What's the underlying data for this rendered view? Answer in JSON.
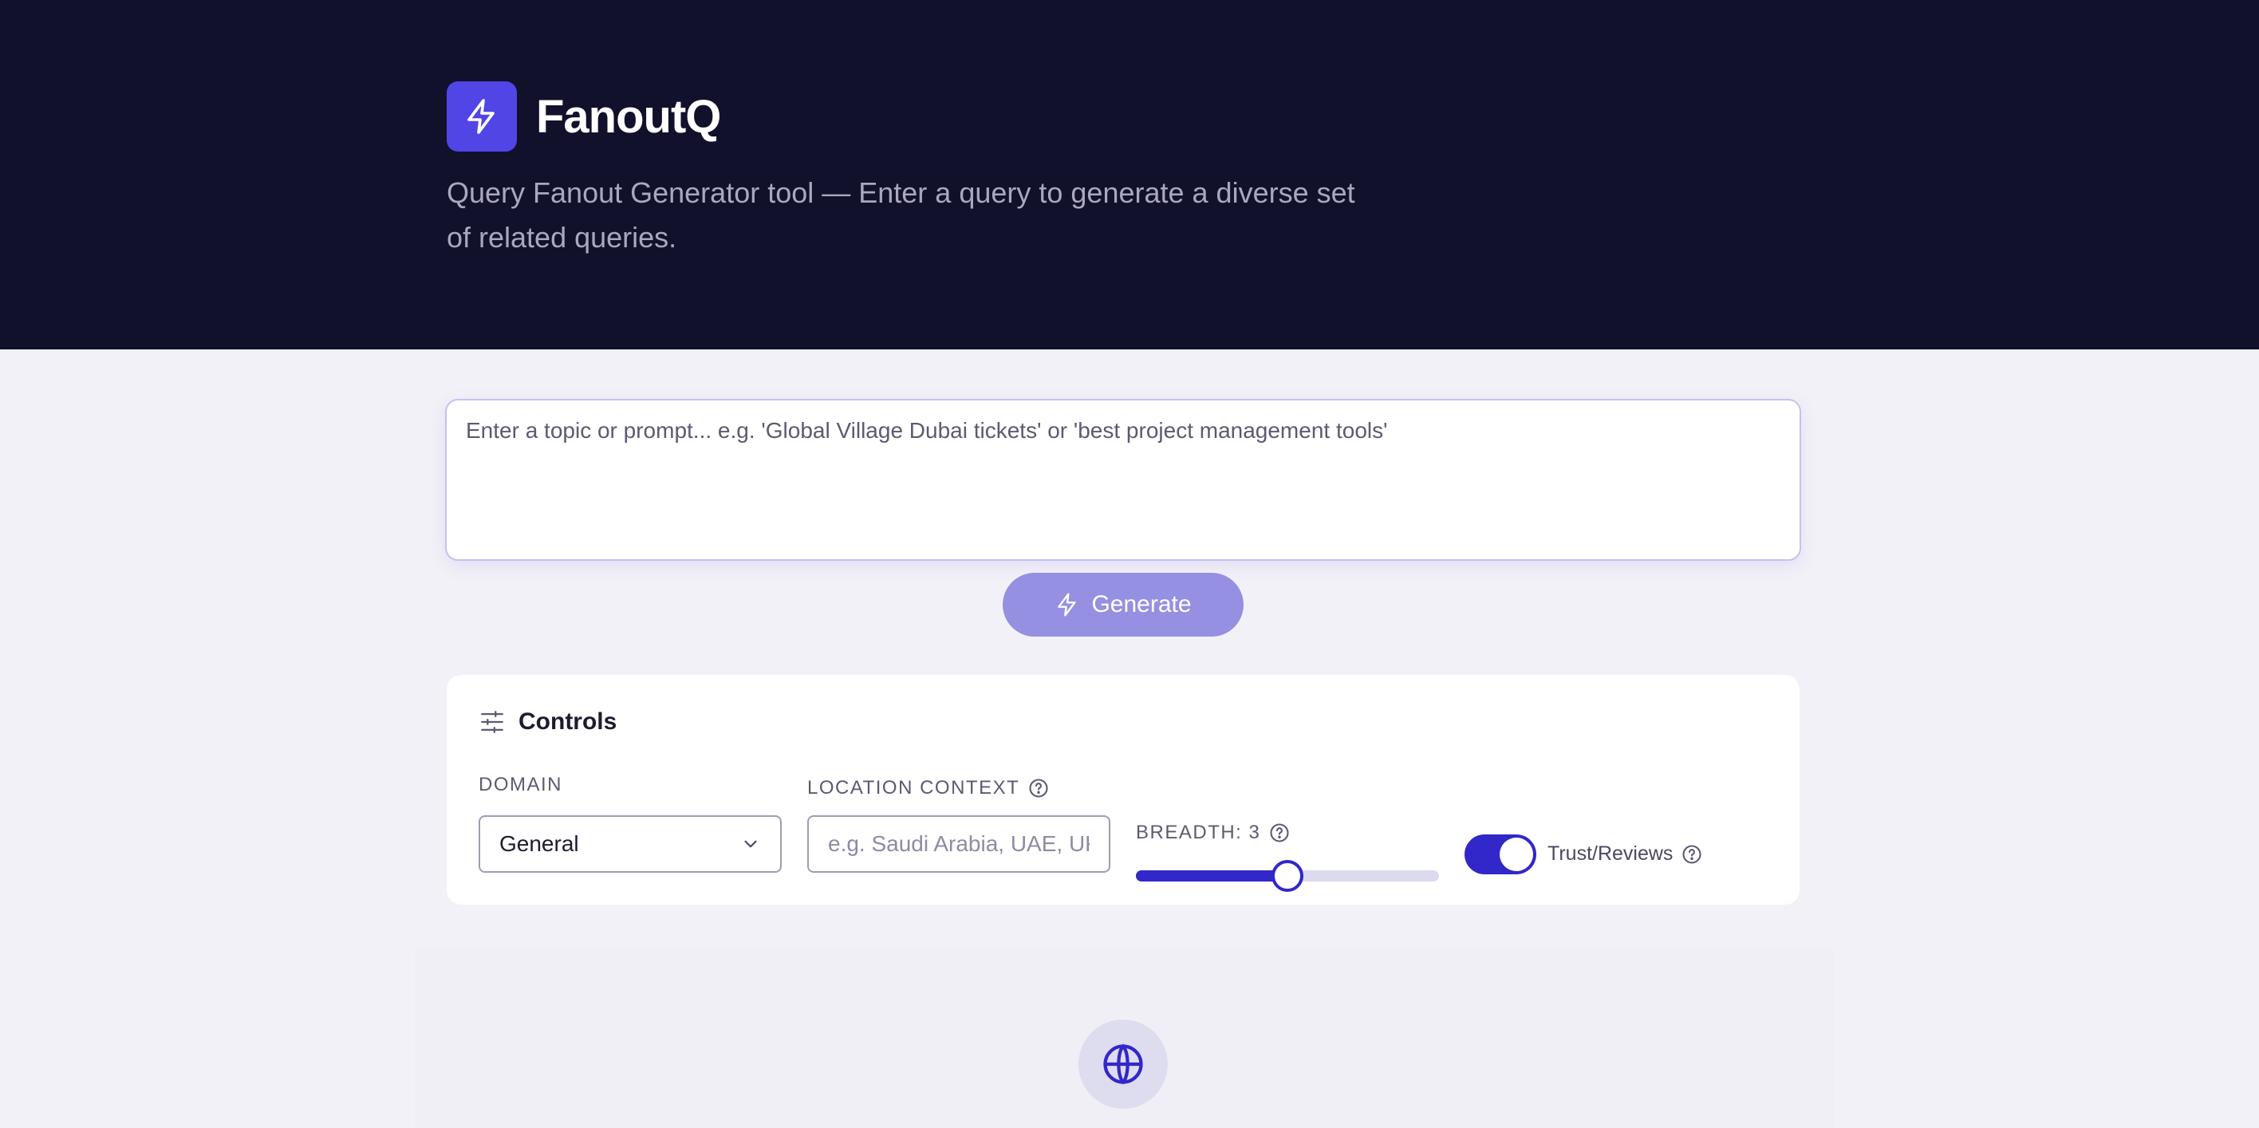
{
  "header": {
    "app_name": "FanoutQ",
    "tagline": "Query Fanout Generator tool — Enter a query to generate a diverse set of related queries.",
    "logo_icon": "lightning-bolt-icon"
  },
  "prompt": {
    "placeholder": "Enter a topic or prompt... e.g. 'Global Village Dubai tickets' or 'best project management tools'",
    "value": ""
  },
  "generate": {
    "label": "Generate",
    "icon": "lightning-bolt-icon",
    "state": "disabled"
  },
  "controls": {
    "title": "Controls",
    "icon": "sliders-icon",
    "domain": {
      "label": "DOMAIN",
      "selected": "General"
    },
    "location": {
      "label": "LOCATION CONTEXT",
      "placeholder": "e.g. Saudi Arabia, UAE, UK",
      "value": ""
    },
    "breadth": {
      "label": "BREADTH: 3",
      "value": 3,
      "min": 1,
      "max": 5
    },
    "trust": {
      "label": "Trust/Reviews",
      "enabled": true
    }
  },
  "empty_state": {
    "icon": "globe-icon"
  },
  "colors": {
    "hero_bg": "#12112c",
    "accent": "#3227c9",
    "logo_bg": "#5145e6",
    "page_bg": "#f2f1f7"
  }
}
